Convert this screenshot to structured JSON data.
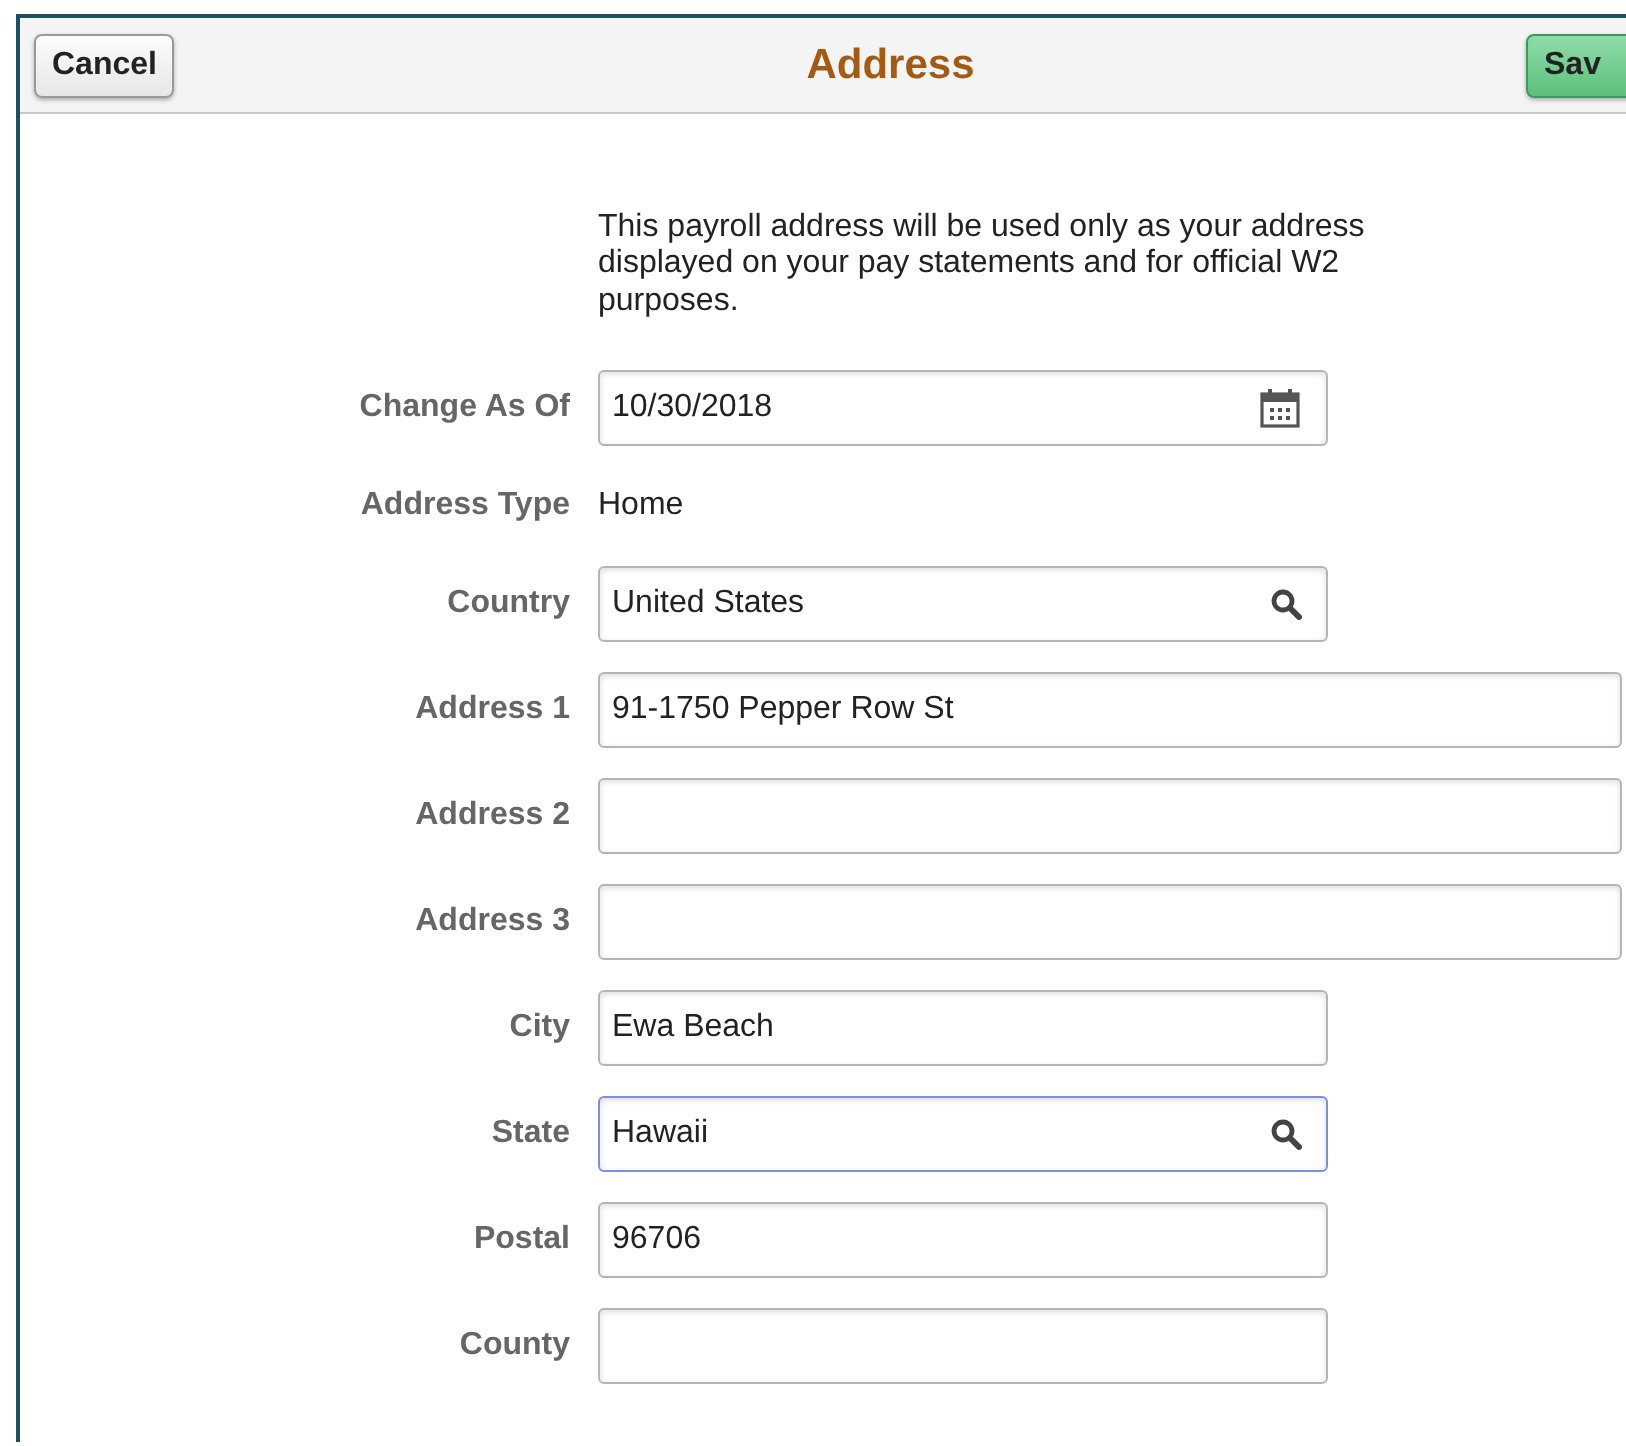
{
  "header": {
    "cancel": "Cancel",
    "title": "Address",
    "save": "Sav"
  },
  "intro": "This payroll address will be used only as your address displayed on your pay statements and for official W2 purposes.",
  "fields": [
    {
      "label": "Change As Of",
      "kind": "date",
      "value": "10/30/2018",
      "wide": false,
      "focused": false
    },
    {
      "label": "Address Type",
      "kind": "static",
      "value": "Home"
    },
    {
      "label": "Country",
      "kind": "lookup",
      "value": "United States",
      "wide": false,
      "focused": false
    },
    {
      "label": "Address 1",
      "kind": "text",
      "value": "91-1750 Pepper Row St",
      "wide": true,
      "focused": false
    },
    {
      "label": "Address 2",
      "kind": "text",
      "wide": true,
      "focused": false
    },
    {
      "label": "Address 3",
      "kind": "text",
      "wide": true,
      "focused": false
    },
    {
      "label": "City",
      "kind": "text",
      "value": "Ewa Beach",
      "wide": false,
      "focused": false
    },
    {
      "label": "State",
      "kind": "lookup",
      "value": "Hawaii",
      "wide": false,
      "focused": true
    },
    {
      "label": "Postal",
      "kind": "text",
      "value": "96706",
      "wide": false,
      "focused": false
    },
    {
      "label": "County",
      "kind": "text",
      "wide": false,
      "focused": false
    }
  ]
}
